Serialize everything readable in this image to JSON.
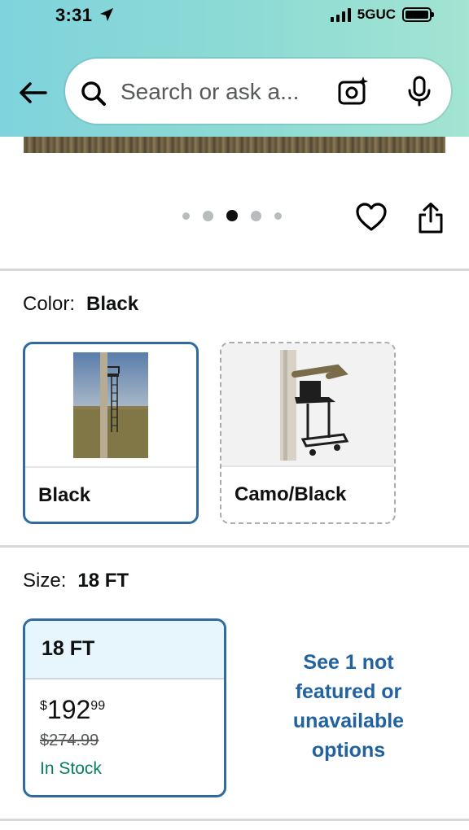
{
  "status_bar": {
    "time": "3:31",
    "network": "5GUC"
  },
  "search": {
    "placeholder": "Search or ask a..."
  },
  "gallery": {
    "dot_count": 5,
    "active_index": 2
  },
  "color": {
    "label": "Color:",
    "selected": "Black",
    "options": [
      {
        "label": "Black",
        "selected": true
      },
      {
        "label": "Camo/Black",
        "selected": false
      }
    ]
  },
  "size": {
    "label": "Size:",
    "selected": "18 FT",
    "card": {
      "title": "18 FT",
      "currency": "$",
      "price_whole": "192",
      "price_fraction": "99",
      "list_price": "$274.99",
      "availability": "In Stock"
    },
    "more_link": "See 1 not featured or unavailable options"
  },
  "colors": {
    "accent_border": "#2f6aa0",
    "link": "#2162a1",
    "in_stock": "#067d62",
    "header_start": "#7fd3dc",
    "header_end": "#a3e4d2"
  }
}
